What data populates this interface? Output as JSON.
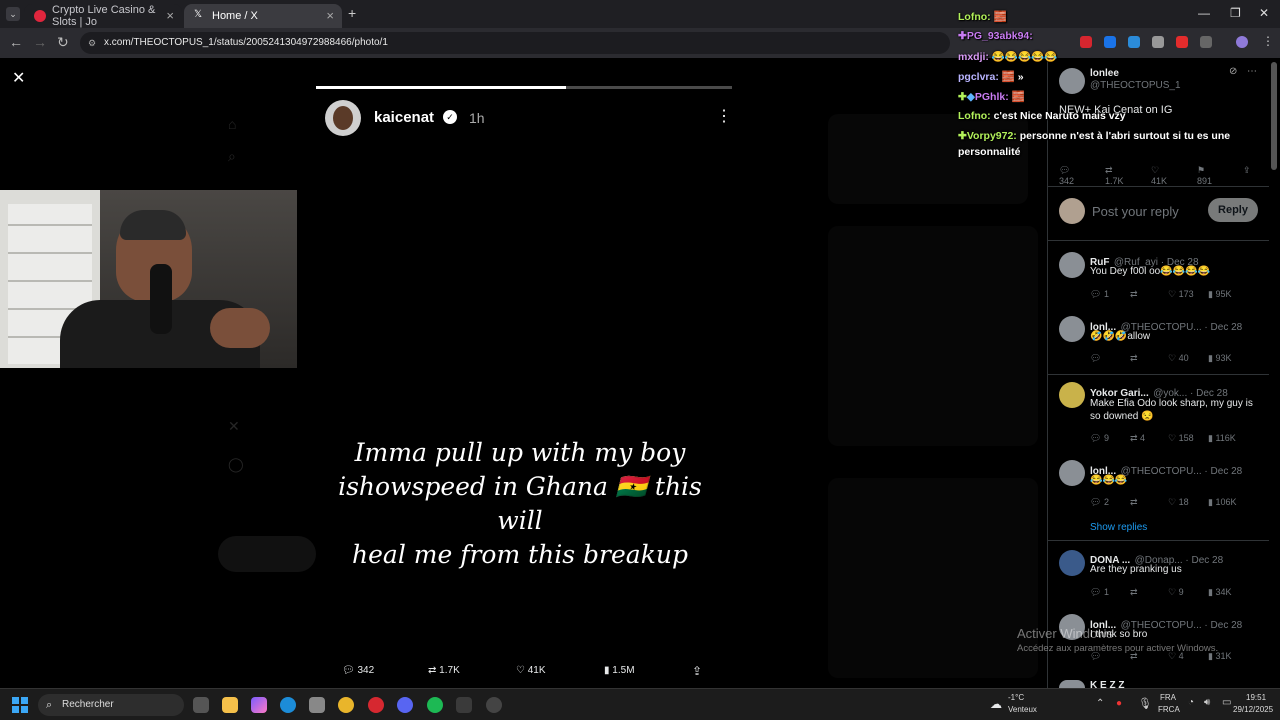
{
  "browser": {
    "tabs": [
      {
        "label": "Crypto Live Casino & Slots | Jo",
        "active": false
      },
      {
        "label": "Home / X",
        "active": true
      }
    ],
    "url": "x.com/THEOCTOPUS_1/status/2005241304972988466/photo/1"
  },
  "story": {
    "username": "kaicenat",
    "time": "1h",
    "caption_line1": "Imma pull up with my boy",
    "caption_line2": "ishowspeed in Ghana 🇬🇭 this will",
    "caption_line3": "heal me from this breakup",
    "progress": 0.6,
    "actions": {
      "replies": "342",
      "reposts": "1.7K",
      "likes": "41K",
      "views": "1.5M"
    }
  },
  "panel": {
    "author_name": "lonlee",
    "author_handle": "@THEOCTOPUS_1",
    "post_text": "NEW+ Kai Cenat on IG",
    "post_stats": {
      "replies": "342",
      "reposts": "1.7K",
      "likes": "41K",
      "bookmarks": "891"
    },
    "reply_placeholder": "Post your reply",
    "reply_button": "Reply",
    "replies": [
      {
        "name": "RuF",
        "handle": "@Ruf_ayi · Dec 28",
        "text": "You Dey f00l oo😂😂😂😂",
        "stats": {
          "c": "1",
          "r": "",
          "l": "173",
          "v": "95K"
        }
      },
      {
        "name": "lonl...",
        "handle": "@THEOCTOPU... · Dec 28",
        "text": "🤣🤣🤣allow",
        "stats": {
          "c": "",
          "r": "",
          "l": "40",
          "v": "93K"
        }
      },
      {
        "name": "Yokor Gari...",
        "handle": "@yok... · Dec 28",
        "text": "Make Efia Odo look sharp, my guy is so downed 😒",
        "stats": {
          "c": "9",
          "r": "4",
          "l": "158",
          "v": "116K"
        }
      },
      {
        "name": "lonl...",
        "handle": "@THEOCTOPU... · Dec 28",
        "text": "😂😂😂",
        "stats": {
          "c": "2",
          "r": "",
          "l": "18",
          "v": "106K"
        }
      },
      {
        "name": "DONA ...",
        "handle": "@Donap... · Dec 28",
        "text": "Are they pranking us",
        "stats": {
          "c": "1",
          "r": "9",
          "l": "",
          "v": "34K"
        }
      },
      {
        "name": "lonl...",
        "handle": "@THEOCTOPU... · Dec 28",
        "text": "I think so bro",
        "stats": {
          "c": "",
          "r": "",
          "l": "4",
          "v": "31K"
        }
      }
    ],
    "show_replies": "Show replies",
    "last_name": "K E Z Z"
  },
  "chat": [
    {
      "user": "Lofno:",
      "msg": "🧱"
    },
    {
      "user": "PG_93abk94:",
      "msg": ""
    },
    {
      "user": "mxdji:",
      "msg": "😂😂😂😂😂"
    },
    {
      "user": "pgclvra:",
      "msg": "🧱"
    },
    {
      "user": "PGhlk:",
      "msg": "🧱"
    },
    {
      "user": "Lofno:",
      "msg": "c'est Nice Naruto mais vzy"
    },
    {
      "user": "Vorpy972:",
      "msg": "personne n'est à l'abri surtout si tu es une"
    },
    {
      "user": "",
      "msg": "personnalité"
    }
  ],
  "watermark": {
    "line1": "Activer Windows",
    "line2": "Accédez aux paramètres pour activer Windows."
  },
  "taskbar": {
    "search": "Rechercher",
    "weather_temp": "-1°C",
    "weather_desc": "Venteux",
    "lang1": "FRA",
    "lang2": "FRCA",
    "time": "19:51",
    "date": "29/12/2025"
  }
}
